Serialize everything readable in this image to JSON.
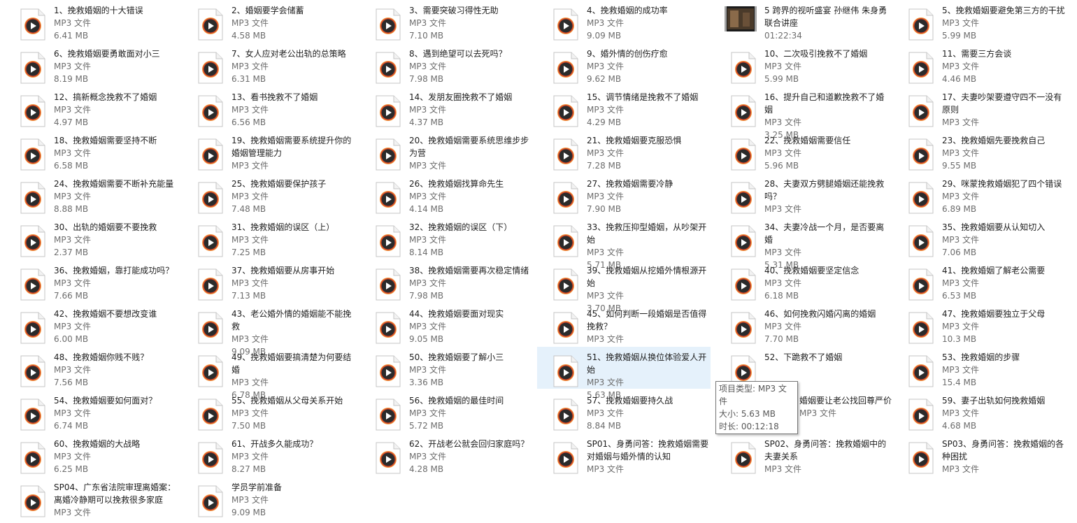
{
  "files": [
    {
      "name": "1、挽救婚姻的十大错误",
      "type": "MP3 文件",
      "size": "6.41 MB"
    },
    {
      "name": "2、婚姻要学会储蓄",
      "type": "MP3 文件",
      "size": "4.58 MB"
    },
    {
      "name": "3、需要突破习得性无助",
      "type": "MP3 文件",
      "size": "7.10 MB"
    },
    {
      "name": "4、挽救婚姻的成功率",
      "type": "MP3 文件",
      "size": "9.09 MB"
    },
    {
      "name": "5 跨界的视听盛宴 孙继伟 朱身勇联合讲座",
      "type": "",
      "size": "01:22:34",
      "video": true
    },
    {
      "name": "5、挽救婚姻要避免第三方的干扰",
      "type": "MP3 文件",
      "size": "5.99 MB"
    },
    {
      "name": "6、挽救婚姻要勇敢面对小三",
      "type": "MP3 文件",
      "size": "8.19 MB"
    },
    {
      "name": "7、女人应对老公出轨的总策略",
      "type": "MP3 文件",
      "size": "6.31 MB"
    },
    {
      "name": "8、遇到绝望可以去死吗？",
      "type": "MP3 文件",
      "size": "7.98 MB"
    },
    {
      "name": "9、婚外情的创伤疗愈",
      "type": "MP3 文件",
      "size": "9.62 MB"
    },
    {
      "name": "10、二次吸引挽救不了婚姻",
      "type": "MP3 文件",
      "size": "5.99 MB"
    },
    {
      "name": "11、需要三方会谈",
      "type": "MP3 文件",
      "size": "4.46 MB"
    },
    {
      "name": "12、搞新概念挽救不了婚姻",
      "type": "MP3 文件",
      "size": "4.97 MB"
    },
    {
      "name": "13、看书挽救不了婚姻",
      "type": "MP3 文件",
      "size": "6.56 MB"
    },
    {
      "name": "14、发朋友圈挽救不了婚姻",
      "type": "MP3 文件",
      "size": "4.37 MB"
    },
    {
      "name": "15、调节情绪是挽救不了婚姻",
      "type": "MP3 文件",
      "size": "4.29 MB"
    },
    {
      "name": "16、提升自己和道歉挽救不了婚姻",
      "type": "MP3 文件",
      "size": "3.25 MB"
    },
    {
      "name": "17、夫妻吵架要遵守四不一没有原则",
      "type": "MP3 文件",
      "size": ""
    },
    {
      "name": "18、挽救婚姻需要坚持不断",
      "type": "MP3 文件",
      "size": "6.58 MB"
    },
    {
      "name": "19、挽救婚姻需要系统提升你的婚姻管理能力",
      "type": "MP3 文件",
      "size": ""
    },
    {
      "name": "20、挽救婚姻需要系统思维步步为营",
      "type": "MP3 文件",
      "size": ""
    },
    {
      "name": "21、挽救婚姻要克服恐惧",
      "type": "MP3 文件",
      "size": "7.28 MB"
    },
    {
      "name": "22、挽救婚姻需要信任",
      "type": "MP3 文件",
      "size": "5.96 MB"
    },
    {
      "name": "23、挽救婚姻先要挽救自己",
      "type": "MP3 文件",
      "size": "9.55 MB"
    },
    {
      "name": "24、挽救婚姻需要不断补充能量",
      "type": "MP3 文件",
      "size": "8.88 MB"
    },
    {
      "name": "25、挽救婚姻要保护孩子",
      "type": "MP3 文件",
      "size": "7.48 MB"
    },
    {
      "name": "26、挽救婚姻找算命先生",
      "type": "MP3 文件",
      "size": "4.14 MB"
    },
    {
      "name": "27、挽救婚姻需要冷静",
      "type": "MP3 文件",
      "size": "7.90 MB"
    },
    {
      "name": "28、夫妻双方劈腿婚姻还能挽救吗？",
      "type": "MP3 文件",
      "size": ""
    },
    {
      "name": "29、咪蒙挽救婚姻犯了四个错误",
      "type": "MP3 文件",
      "size": "6.89 MB"
    },
    {
      "name": "30、出轨的婚姻要不要挽救",
      "type": "MP3 文件",
      "size": "2.37 MB"
    },
    {
      "name": "31、挽救婚姻的误区（上）",
      "type": "MP3 文件",
      "size": "7.25 MB"
    },
    {
      "name": "32、挽救婚姻的误区（下）",
      "type": "MP3 文件",
      "size": "8.14 MB"
    },
    {
      "name": "33、挽救压抑型婚姻，从吵架开始",
      "type": "MP3 文件",
      "size": "5.71 MB"
    },
    {
      "name": "34、夫妻冷战一个月，是否要离婚",
      "type": "MP3 文件",
      "size": "5.31 MB"
    },
    {
      "name": "35、挽救婚姻要从认知切入",
      "type": "MP3 文件",
      "size": "7.06 MB"
    },
    {
      "name": "36、挽救婚姻，靠打能成功吗？",
      "type": "MP3 文件",
      "size": "7.66 MB"
    },
    {
      "name": "37、挽救婚姻要从房事开始",
      "type": "MP3 文件",
      "size": "7.13 MB"
    },
    {
      "name": "38、挽救婚姻需要再次稳定情绪",
      "type": "MP3 文件",
      "size": "7.98 MB"
    },
    {
      "name": "39、挽救婚姻从挖婚外情根源开始",
      "type": "MP3 文件",
      "size": "3.70 MB"
    },
    {
      "name": "40、挽救婚姻要坚定信念",
      "type": "MP3 文件",
      "size": "6.18 MB"
    },
    {
      "name": "41、挽救婚姻了解老公需要",
      "type": "MP3 文件",
      "size": "6.53 MB"
    },
    {
      "name": "42、挽救婚姻不要想改变谁",
      "type": "MP3 文件",
      "size": "6.00 MB"
    },
    {
      "name": "43、老公婚外情的婚姻能不能挽救",
      "type": "MP3 文件",
      "size": "9.09 MB"
    },
    {
      "name": "44、挽救婚姻要面对现实",
      "type": "MP3 文件",
      "size": "9.05 MB"
    },
    {
      "name": "45、如何判断一段婚姻是否值得挽救？",
      "type": "MP3 文件",
      "size": ""
    },
    {
      "name": "46、如何挽救闪婚闪离的婚姻",
      "type": "MP3 文件",
      "size": "7.70 MB"
    },
    {
      "name": "47、挽救婚姻要独立于父母",
      "type": "MP3 文件",
      "size": "10.3 MB"
    },
    {
      "name": "48、挽救婚姻你贱不贱？",
      "type": "MP3 文件",
      "size": "7.56 MB"
    },
    {
      "name": "49、挽救婚姻要搞清楚为何要结婚",
      "type": "MP3 文件",
      "size": "6.78 MB"
    },
    {
      "name": "50、挽救婚姻要了解小三",
      "type": "MP3 文件",
      "size": "3.36 MB"
    },
    {
      "name": "51、挽救婚姻从换位体验爱人开始",
      "type": "MP3 文件",
      "size": "5.63 MB",
      "selected": true
    },
    {
      "name": "52、下跪救不了婚姻",
      "type": "",
      "size": ""
    },
    {
      "name": "53、挽救婚姻的步骤",
      "type": "MP3 文件",
      "size": "15.4 MB"
    },
    {
      "name": "54、挽救婚姻要如何面对？",
      "type": "MP3 文件",
      "size": "6.74 MB"
    },
    {
      "name": "55、挽救婚姻从父母关系开始",
      "type": "MP3 文件",
      "size": "7.50 MB"
    },
    {
      "name": "56、挽救婚姻的最佳时间",
      "type": "MP3 文件",
      "size": "5.72 MB"
    },
    {
      "name": "57、挽救婚姻要持久战",
      "type": "MP3 文件",
      "size": "8.84 MB"
    },
    {
      "name": "婚姻要让老公找回尊严价",
      "type": "MP3 文件",
      "size": "",
      "partial": true
    },
    {
      "name": "59、妻子出轨如何挽救婚姻",
      "type": "MP3 文件",
      "size": "4.68 MB"
    },
    {
      "name": "60、挽救婚姻的大战略",
      "type": "MP3 文件",
      "size": "6.25 MB"
    },
    {
      "name": "61、开战多久能成功？",
      "type": "MP3 文件",
      "size": "8.27 MB"
    },
    {
      "name": "62、开战老公就会回归家庭吗？",
      "type": "MP3 文件",
      "size": "4.28 MB"
    },
    {
      "name": "SP01、身勇问答：挽救婚姻需要对婚姻与婚外情的认知",
      "type": "MP3 文件",
      "size": ""
    },
    {
      "name": "SP02、身勇问答：挽救婚姻中的夫妻关系",
      "type": "MP3 文件",
      "size": ""
    },
    {
      "name": "SP03、身勇问答：挽救婚姻的各种困扰",
      "type": "MP3 文件",
      "size": ""
    },
    {
      "name": "SP04、广东省法院审理离婚案：离婚冷静期可以挽救很多家庭",
      "type": "MP3 文件",
      "size": ""
    },
    {
      "name": "学员学前准备",
      "type": "MP3 文件",
      "size": "9.09 MB"
    }
  ],
  "tooltip": {
    "line1": "项目类型: MP3 文件",
    "line2": "大小: 5.63 MB",
    "line3": "时长: 00:12:18"
  },
  "colors": {
    "selected_bg": "#e5f1fb",
    "subtext": "#6d6d6d",
    "icon_ring": "#e85a1e"
  },
  "icons": {
    "audio": "mp3-file-icon",
    "video": "video-thumbnail-icon"
  }
}
